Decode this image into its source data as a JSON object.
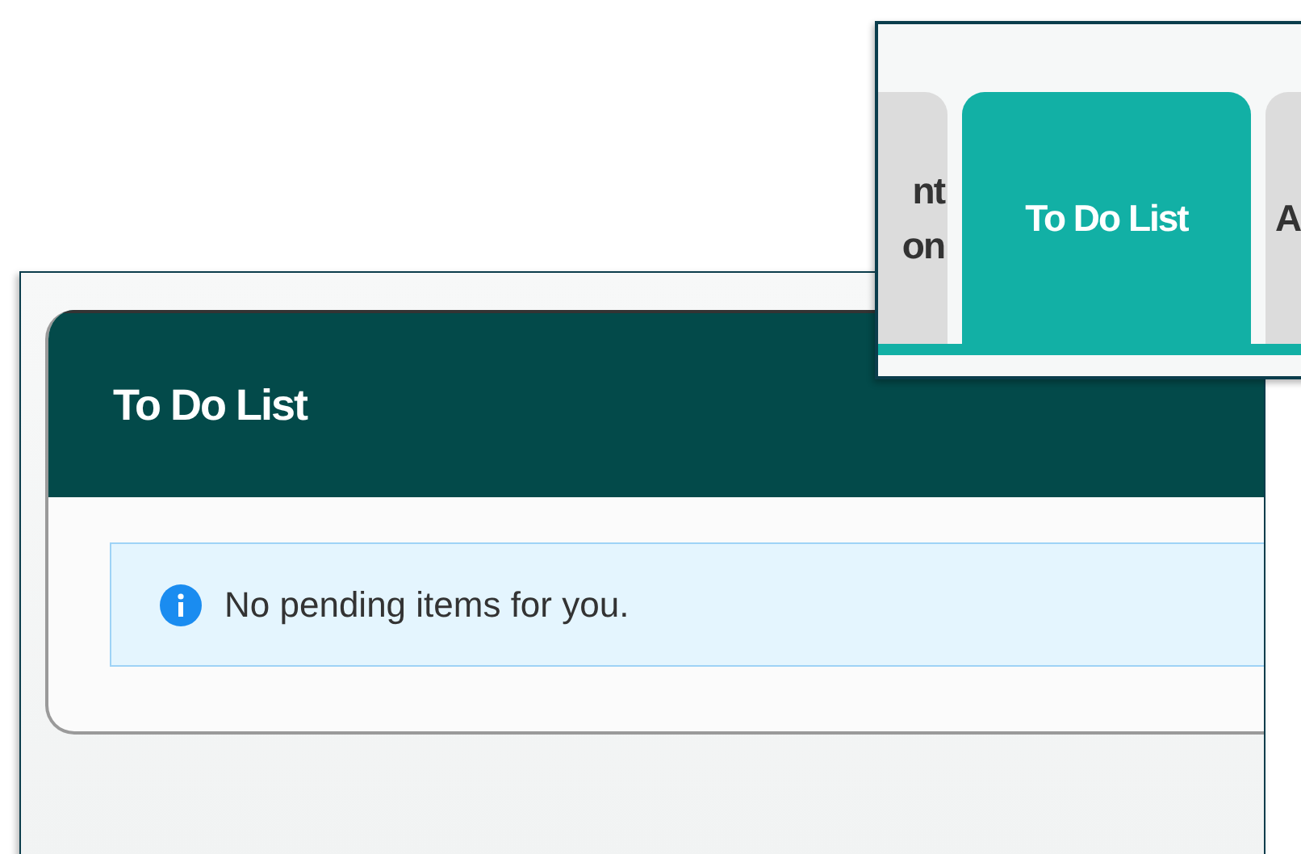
{
  "todo_card": {
    "title": "To Do List",
    "alert": {
      "kind": "info",
      "message": "No pending items for you."
    }
  },
  "tabs": [
    {
      "label": "nt\non",
      "selected": false
    },
    {
      "label": "To Do List",
      "selected": true
    },
    {
      "label": "A",
      "selected": false
    }
  ]
}
